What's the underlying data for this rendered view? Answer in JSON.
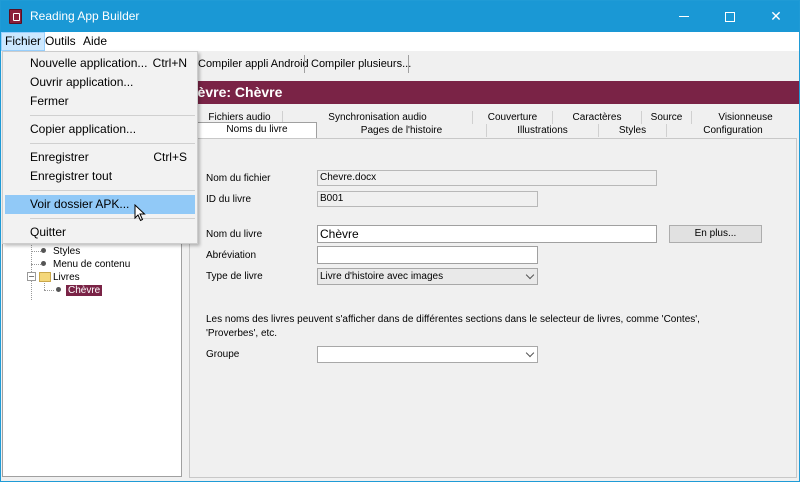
{
  "window": {
    "title": "Reading App Builder"
  },
  "menubar": {
    "items": [
      "Fichier",
      "Outils",
      "Aide"
    ]
  },
  "toolbar": {
    "buttons": [
      "Compiler appli Android",
      "Compiler plusieurs..."
    ]
  },
  "file_menu": {
    "items": [
      {
        "label": "Nouvelle application...",
        "shortcut": "Ctrl+N"
      },
      {
        "label": "Ouvrir application...",
        "shortcut": ""
      },
      {
        "label": "Fermer",
        "shortcut": ""
      },
      {
        "label": "Copier application...",
        "shortcut": ""
      },
      {
        "label": "Enregistrer",
        "shortcut": "Ctrl+S"
      },
      {
        "label": "Enregistrer tout",
        "shortcut": ""
      },
      {
        "label": "Voir dossier APK...",
        "shortcut": ""
      },
      {
        "label": "Quitter",
        "shortcut": ""
      }
    ]
  },
  "tree": {
    "items": [
      "Styles",
      "Menu de contenu",
      "Livres",
      "Chèvre"
    ]
  },
  "book": {
    "header": "hèvre: Chèvre"
  },
  "tabs": {
    "row1": [
      "Fichiers audio",
      "Synchronisation audio",
      "Couverture",
      "Caractères",
      "Source",
      "Visionneuse"
    ],
    "row2": [
      "Noms du livre",
      "Pages de l'histoire",
      "Illustrations",
      "Styles",
      "Configuration"
    ]
  },
  "form": {
    "filename_label": "Nom du fichier",
    "filename_value": "Chevre.docx",
    "bookid_label": "ID du livre",
    "bookid_value": "B001",
    "bookname_label": "Nom du livre",
    "bookname_value": "Chèvre",
    "more_button": "En plus...",
    "abbrev_label": "Abréviation",
    "abbrev_value": "",
    "booktype_label": "Type de livre",
    "booktype_value": "Livre d'histoire avec images",
    "info_text": "Les noms des livres peuvent s'afficher dans de différentes sections dans le selecteur de livres, comme 'Contes', 'Proverbes', etc.",
    "group_label": "Groupe",
    "group_value": ""
  },
  "colors": {
    "titlebar": "#1a98d5",
    "accent": "#7a2346",
    "menu_hover": "#91c9f7"
  }
}
